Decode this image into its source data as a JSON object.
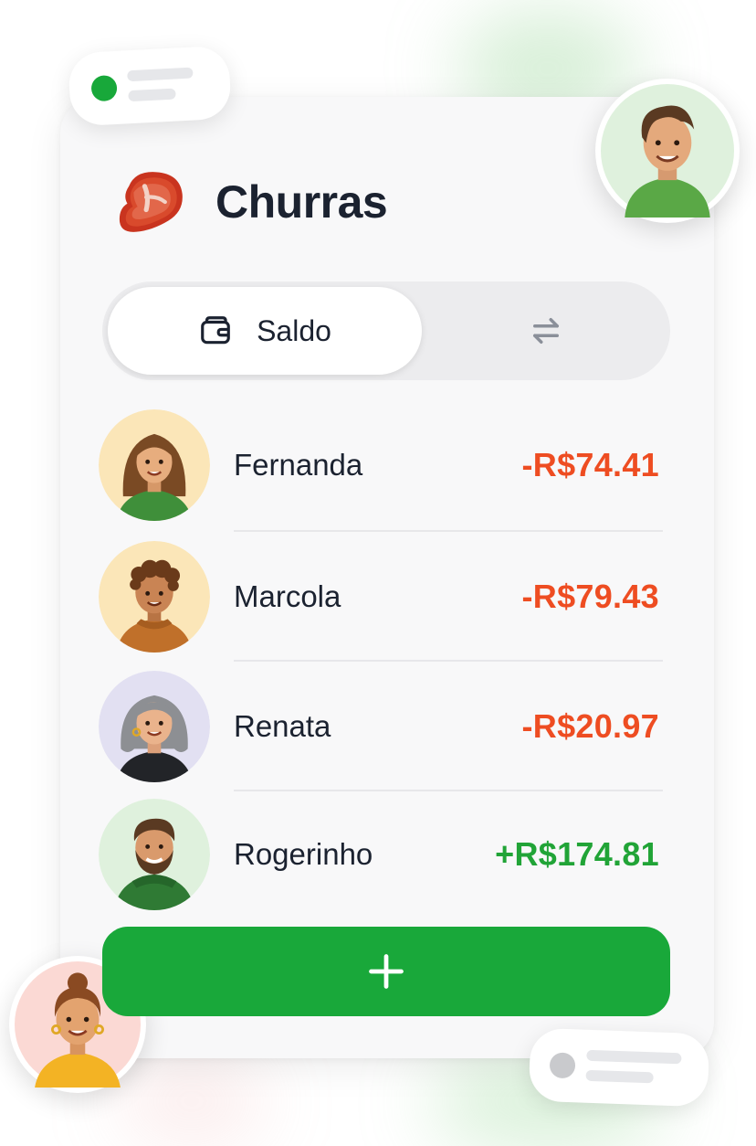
{
  "app": {
    "title": "Churras"
  },
  "tabs": [
    {
      "label": "Saldo",
      "icon": "wallet-icon",
      "active": true
    },
    {
      "label": "",
      "icon": "swap-arrows-icon",
      "active": false
    }
  ],
  "balances": [
    {
      "name": "Fernanda",
      "amount": "-R$74.41",
      "status": "negative"
    },
    {
      "name": "Marcola",
      "amount": "-R$79.43",
      "status": "negative"
    },
    {
      "name": "Renata",
      "amount": "-R$20.97",
      "status": "negative"
    },
    {
      "name": "Rogerinho",
      "amount": "+R$174.81",
      "status": "positive"
    }
  ],
  "actions": {
    "add_icon": "plus-icon"
  },
  "colors": {
    "accent": "#19a83a",
    "negative": "#ee4d22",
    "positive": "#21a437",
    "title": "#1b2230"
  }
}
